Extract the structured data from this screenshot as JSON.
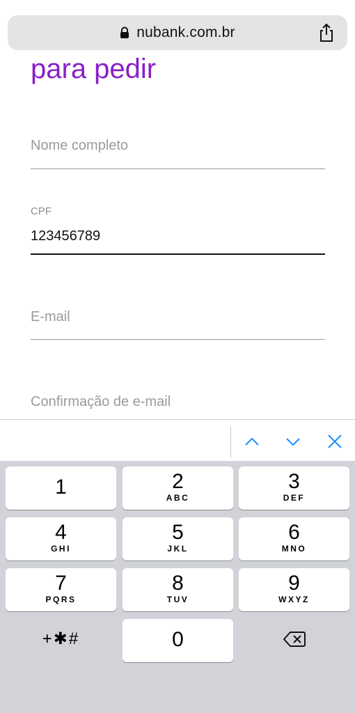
{
  "browser": {
    "url": "nubank.com.br",
    "lock_icon": "lock-icon",
    "share_icon": "share-icon"
  },
  "page": {
    "heading": "para pedir",
    "heading_color": "#8a1ec9",
    "fields": [
      {
        "placeholder": "Nome completo"
      },
      {
        "label": "CPF",
        "value": "123456789"
      },
      {
        "placeholder": "E-mail"
      },
      {
        "placeholder": "Confirmação de e-mail"
      }
    ]
  },
  "accessory": {
    "prev_icon": "chevron-up-icon",
    "next_icon": "chevron-down-icon",
    "close_icon": "close-icon",
    "accent": "#1a8cff"
  },
  "keyboard": {
    "keys": [
      {
        "digit": "1",
        "letters": ""
      },
      {
        "digit": "2",
        "letters": "ABC"
      },
      {
        "digit": "3",
        "letters": "DEF"
      },
      {
        "digit": "4",
        "letters": "GHI"
      },
      {
        "digit": "5",
        "letters": "JKL"
      },
      {
        "digit": "6",
        "letters": "MNO"
      },
      {
        "digit": "7",
        "letters": "PQRS"
      },
      {
        "digit": "8",
        "letters": "TUV"
      },
      {
        "digit": "9",
        "letters": "WXYZ"
      },
      {
        "digit": "0",
        "letters": ""
      }
    ],
    "symbols": "+✱#",
    "delete_icon": "backspace-icon"
  }
}
